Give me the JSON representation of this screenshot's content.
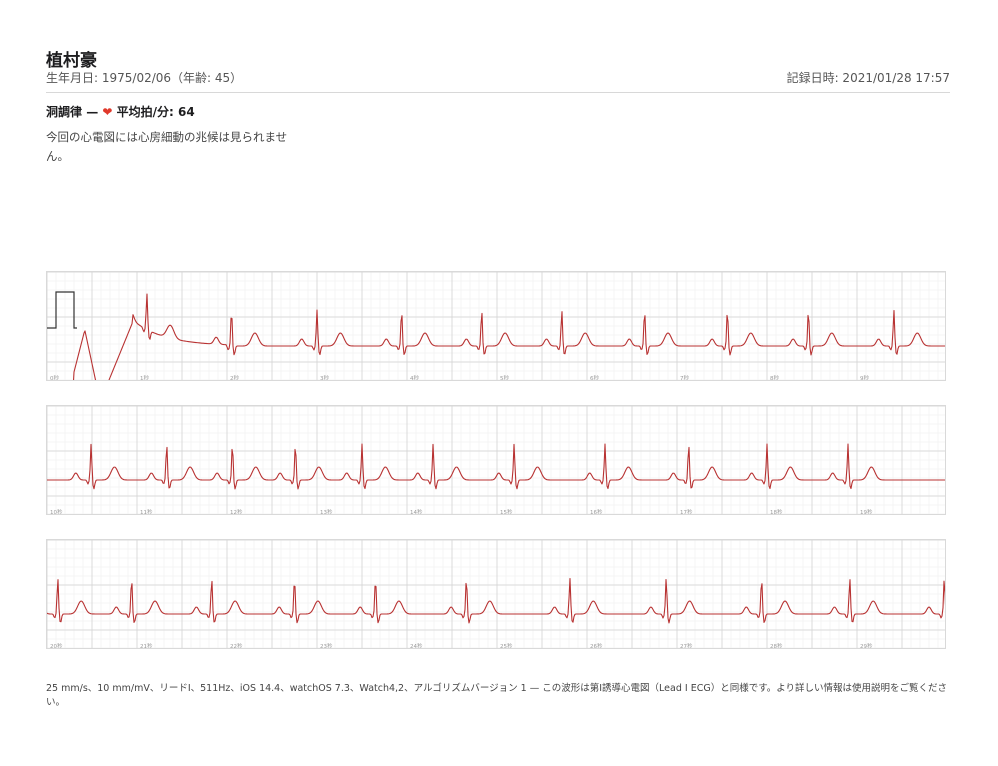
{
  "patient": {
    "name": "植村豪",
    "birth": "生年月日: 1975/02/06（年齢: 45）",
    "recorded": "記録日時: 2021/01/28 17:57"
  },
  "result": {
    "rhythm": "洞調律",
    "dash": "—",
    "heart_icon": "heart-icon",
    "avg_hr": "平均拍/分: 64",
    "summary": "今回の心電図には心房細動の兆候は見られません。"
  },
  "colors": {
    "trace": "#b83232",
    "grid_minor": "#eeeeee",
    "grid_major": "#d0d0d0",
    "heart": "#e0392b"
  },
  "strips": [
    {
      "labels": [
        "0秒",
        "1秒",
        "2秒",
        "3秒",
        "4秒",
        "5秒",
        "6秒",
        "7秒",
        "8秒",
        "9秒"
      ],
      "beats": [
        1.11,
        2.05,
        3.0,
        3.94,
        4.83,
        5.72,
        6.64,
        7.56,
        8.46,
        9.41
      ]
    },
    {
      "labels": [
        "10秒",
        "11秒",
        "12秒",
        "13秒",
        "14秒",
        "15秒",
        "16秒",
        "17秒",
        "18秒",
        "19秒"
      ],
      "beats": [
        10.49,
        11.33,
        12.06,
        12.76,
        13.5,
        14.29,
        15.19,
        16.2,
        17.13,
        18.0,
        18.9
      ]
    },
    {
      "labels": [
        "20秒",
        "21秒",
        "22秒",
        "23秒",
        "24秒",
        "25秒",
        "26秒",
        "27秒",
        "28秒",
        "29秒"
      ],
      "beats": [
        20.12,
        20.94,
        21.83,
        22.75,
        23.65,
        24.66,
        25.81,
        26.88,
        27.94,
        28.92,
        29.97
      ]
    }
  ],
  "footer": "25 mm/s、10 mm/mV、リードI、511Hz、iOS 14.4、watchOS 7.3、Watch4,2、アルゴリズムバージョン 1 — この波形は第I誘導心電図（Lead I ECG）と同様です。より詳しい情報は使用説明をご覧ください。"
}
